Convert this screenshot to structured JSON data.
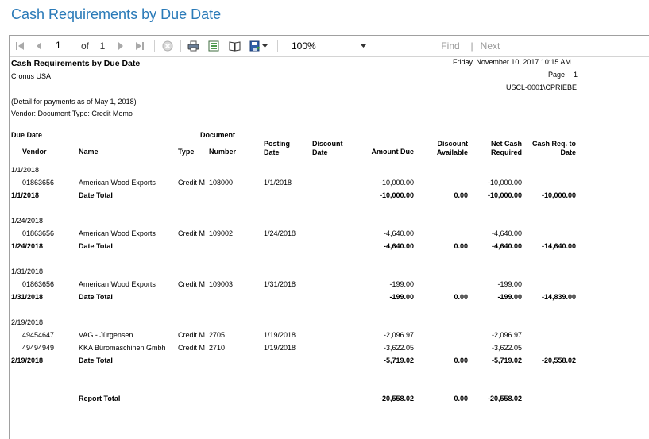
{
  "page_title": "Cash Requirements by Due Date",
  "toolbar": {
    "current_page": "1",
    "of_label": "of",
    "total_pages": "1",
    "zoom": "100%",
    "find_label": "Find",
    "separator": "|",
    "next_label": "Next"
  },
  "report": {
    "title": "Cash Requirements by Due Date",
    "company": "Cronus USA",
    "run_datetime": "Friday, November 10, 2017 10:15 AM",
    "page_label": "Page",
    "page_number": "1",
    "user": "USCL-0001\\CPRIEBE",
    "detail_note": "(Detail for payments as of May 1, 2018)",
    "filter_note": "Vendor: Document Type: Credit Memo",
    "headers": {
      "due_date": "Due Date",
      "vendor": "Vendor",
      "name": "Name",
      "document": "Document",
      "type": "Type",
      "number": "Number",
      "posting_date_1": "Posting",
      "posting_date_2": "Date",
      "discount_date_1": "Discount",
      "discount_date_2": "Date",
      "amount_due": "Amount Due",
      "discount_available_1": "Discount",
      "discount_available_2": "Available",
      "net_cash_1": "Net Cash",
      "net_cash_2": "Required",
      "cash_req_1": "Cash Req. to",
      "cash_req_2": "Date"
    },
    "groups": [
      {
        "due_date": "1/1/2018",
        "lines": [
          {
            "vendor": "01863656",
            "name": "American Wood Exports",
            "type": "Credit M",
            "number": "108000",
            "posting_date": "1/1/2018",
            "amount_due": "-10,000.00",
            "net_cash": "-10,000.00"
          }
        ],
        "total": {
          "label_date": "1/1/2018",
          "label": "Date Total",
          "amount_due": "-10,000.00",
          "discount": "0.00",
          "net_cash": "-10,000.00",
          "cash_to_date": "-10,000.00"
        }
      },
      {
        "due_date": "1/24/2018",
        "lines": [
          {
            "vendor": "01863656",
            "name": "American Wood Exports",
            "type": "Credit M",
            "number": "109002",
            "posting_date": "1/24/2018",
            "amount_due": "-4,640.00",
            "net_cash": "-4,640.00"
          }
        ],
        "total": {
          "label_date": "1/24/2018",
          "label": "Date Total",
          "amount_due": "-4,640.00",
          "discount": "0.00",
          "net_cash": "-4,640.00",
          "cash_to_date": "-14,640.00"
        }
      },
      {
        "due_date": "1/31/2018",
        "lines": [
          {
            "vendor": "01863656",
            "name": "American Wood Exports",
            "type": "Credit M",
            "number": "109003",
            "posting_date": "1/31/2018",
            "amount_due": "-199.00",
            "net_cash": "-199.00"
          }
        ],
        "total": {
          "label_date": "1/31/2018",
          "label": "Date Total",
          "amount_due": "-199.00",
          "discount": "0.00",
          "net_cash": "-199.00",
          "cash_to_date": "-14,839.00"
        }
      },
      {
        "due_date": "2/19/2018",
        "lines": [
          {
            "vendor": "49454647",
            "name": "VAG - Jürgensen",
            "type": "Credit M",
            "number": "2705",
            "posting_date": "1/19/2018",
            "amount_due": "-2,096.97",
            "net_cash": "-2,096.97"
          },
          {
            "vendor": "49494949",
            "name": "KKA Büromaschinen Gmbh",
            "type": "Credit M",
            "number": "2710",
            "posting_date": "1/19/2018",
            "amount_due": "-3,622.05",
            "net_cash": "-3,622.05"
          }
        ],
        "total": {
          "label_date": "2/19/2018",
          "label": "Date Total",
          "amount_due": "-5,719.02",
          "discount": "0.00",
          "net_cash": "-5,719.02",
          "cash_to_date": "-20,558.02"
        }
      }
    ],
    "report_total": {
      "label": "Report Total",
      "amount_due": "-20,558.02",
      "discount": "0.00",
      "net_cash": "-20,558.02"
    }
  }
}
